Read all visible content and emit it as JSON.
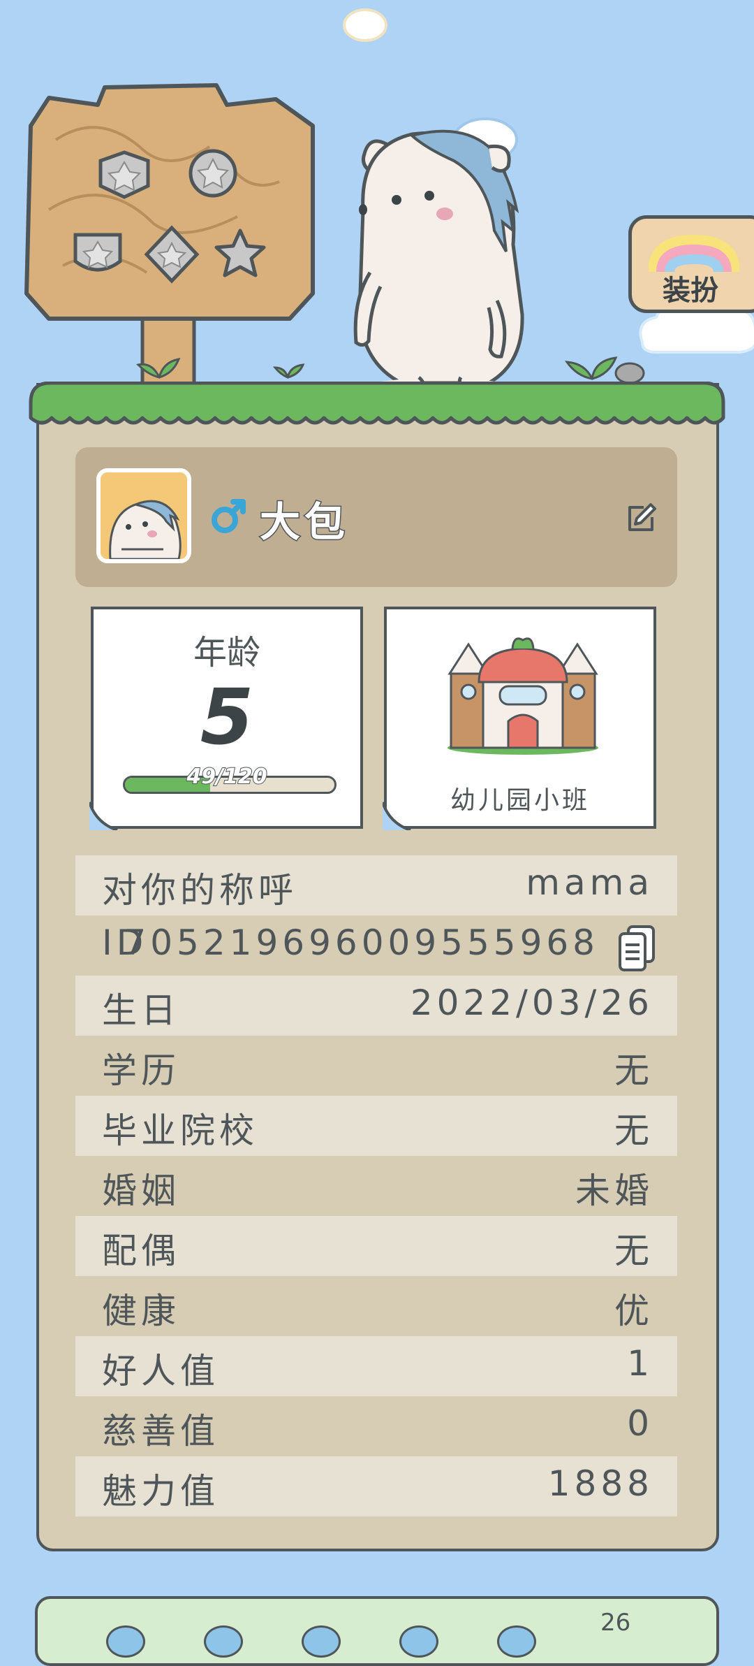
{
  "dressup": {
    "label": "装扮"
  },
  "profile": {
    "name": "大包",
    "gender_icon": "male-symbol-icon",
    "edit_icon": "edit-pencil-icon"
  },
  "age_card": {
    "label": "年龄",
    "value": "5",
    "progress_text": "49/120",
    "progress_fraction": 0.408
  },
  "school_card": {
    "label": "幼儿园小班"
  },
  "info": {
    "address": {
      "label": "对你的称呼",
      "value": "mama"
    },
    "id": {
      "label": "ID",
      "value": "7052196960095559​68"
    },
    "birthday": {
      "label": "生日",
      "value": "2022/03/26"
    },
    "education": {
      "label": "学历",
      "value": "无"
    },
    "school": {
      "label": "毕业院校",
      "value": "无"
    },
    "marriage": {
      "label": "婚姻",
      "value": "未婚"
    },
    "spouse": {
      "label": "配偶",
      "value": "无"
    },
    "health": {
      "label": "健康",
      "value": "优"
    },
    "goodness": {
      "label": "好人值",
      "value": "1"
    },
    "charity": {
      "label": "慈善值",
      "value": "0"
    },
    "charm": {
      "label": "魅力值",
      "value": "1888"
    }
  },
  "bottom_panel": {
    "number": "26"
  },
  "colors": {
    "sky": "#afd3f5",
    "board": "#d7ccb4",
    "header": "#bfae92",
    "grass": "#6cb85f",
    "outline": "#4f5659",
    "gender": "#3aa6d8"
  }
}
